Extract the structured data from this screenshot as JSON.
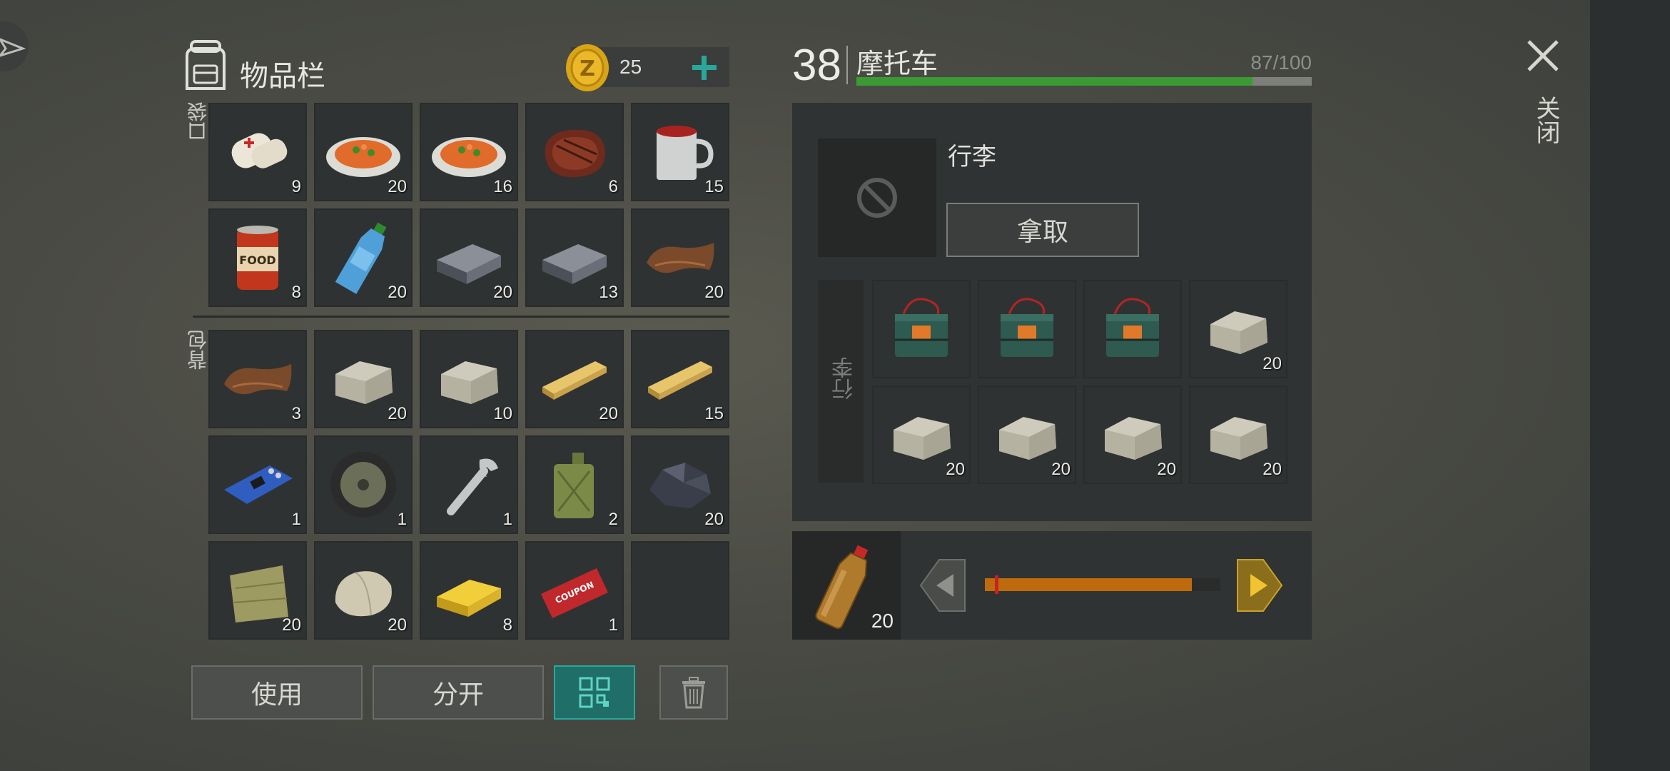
{
  "inventory": {
    "title": "物品栏",
    "coins": "25",
    "pocket_label": "口袋",
    "backpack_label": "背包",
    "pocket_items": [
      {
        "icon": "bandage-icon",
        "qty": "9"
      },
      {
        "icon": "food-plate-icon",
        "qty": "20"
      },
      {
        "icon": "food-plate-icon",
        "qty": "16"
      },
      {
        "icon": "steak-icon",
        "qty": "6"
      },
      {
        "icon": "mug-icon",
        "qty": "15"
      },
      {
        "icon": "canned-food-icon",
        "qty": "8"
      },
      {
        "icon": "water-bottle-icon",
        "qty": "20"
      },
      {
        "icon": "iron-bar-icon",
        "qty": "20"
      },
      {
        "icon": "iron-bar-icon",
        "qty": "13"
      },
      {
        "icon": "leather-icon",
        "qty": "20"
      }
    ],
    "backpack_items": [
      {
        "icon": "leather-icon",
        "qty": "3"
      },
      {
        "icon": "stone-block-icon",
        "qty": "20"
      },
      {
        "icon": "stone-block-icon",
        "qty": "10"
      },
      {
        "icon": "plank-icon",
        "qty": "20"
      },
      {
        "icon": "plank-icon",
        "qty": "15"
      },
      {
        "icon": "circuit-board-icon",
        "qty": "1"
      },
      {
        "icon": "wheel-icon",
        "qty": "1"
      },
      {
        "icon": "wrench-icon",
        "qty": "1"
      },
      {
        "icon": "jerrycan-icon",
        "qty": "2"
      },
      {
        "icon": "coal-icon",
        "qty": "20"
      },
      {
        "icon": "cloth-icon",
        "qty": "20"
      },
      {
        "icon": "rock-icon",
        "qty": "20"
      },
      {
        "icon": "gold-bar-icon",
        "qty": "8"
      },
      {
        "icon": "coupon-icon",
        "qty": "1"
      },
      {
        "icon": "empty-slot",
        "qty": ""
      }
    ],
    "buttons": {
      "use": "使用",
      "split": "分开"
    }
  },
  "vehicle": {
    "level": "38",
    "name": "摩托车",
    "durability_text": "87/100",
    "durability_fraction": 0.87,
    "luggage_title": "行李",
    "take_button": "拿取",
    "luggage_side_label": "行李",
    "luggage_items": [
      {
        "icon": "battery-icon",
        "qty": ""
      },
      {
        "icon": "battery-icon",
        "qty": ""
      },
      {
        "icon": "battery-icon",
        "qty": ""
      },
      {
        "icon": "stone-block-icon",
        "qty": "20"
      },
      {
        "icon": "stone-block-icon",
        "qty": "20"
      },
      {
        "icon": "stone-block-icon",
        "qty": "20"
      },
      {
        "icon": "stone-block-icon",
        "qty": "20"
      },
      {
        "icon": "stone-block-icon",
        "qty": "20"
      }
    ],
    "fuel": {
      "icon": "fuel-bottle-icon",
      "qty": "20",
      "level_fraction": 0.88
    }
  },
  "close_label": "关闭",
  "colors": {
    "accent": "#2aa79b",
    "durability": "#3c9a32",
    "fuel": "#c06a0e",
    "arrow_active": "#c9a12a"
  }
}
